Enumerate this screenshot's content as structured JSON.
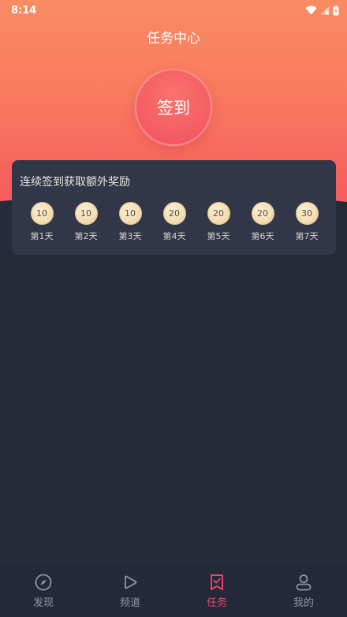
{
  "status_bar": {
    "time": "8:14"
  },
  "header": {
    "title": "任务中心"
  },
  "sign_in": {
    "label": "签到"
  },
  "rewards": {
    "title": "连续签到获取额外奖励",
    "days": [
      {
        "points": "10",
        "label": "第1天"
      },
      {
        "points": "10",
        "label": "第2天"
      },
      {
        "points": "10",
        "label": "第3天"
      },
      {
        "points": "20",
        "label": "第4天"
      },
      {
        "points": "20",
        "label": "第5天"
      },
      {
        "points": "20",
        "label": "第6天"
      },
      {
        "points": "30",
        "label": "第7天"
      }
    ]
  },
  "tabs": [
    {
      "label": "发现",
      "icon": "compass-icon",
      "active": false
    },
    {
      "label": "频道",
      "icon": "play-icon",
      "active": false
    },
    {
      "label": "任务",
      "icon": "bookmark-check-icon",
      "active": true
    },
    {
      "label": "我的",
      "icon": "user-icon",
      "active": false
    }
  ],
  "colors": {
    "accent": "#f0436b",
    "background": "#252b39",
    "card": "#313648",
    "hero_top": "#f98b63",
    "hero_bottom": "#f2575c",
    "coin": "#f3ddb5"
  }
}
